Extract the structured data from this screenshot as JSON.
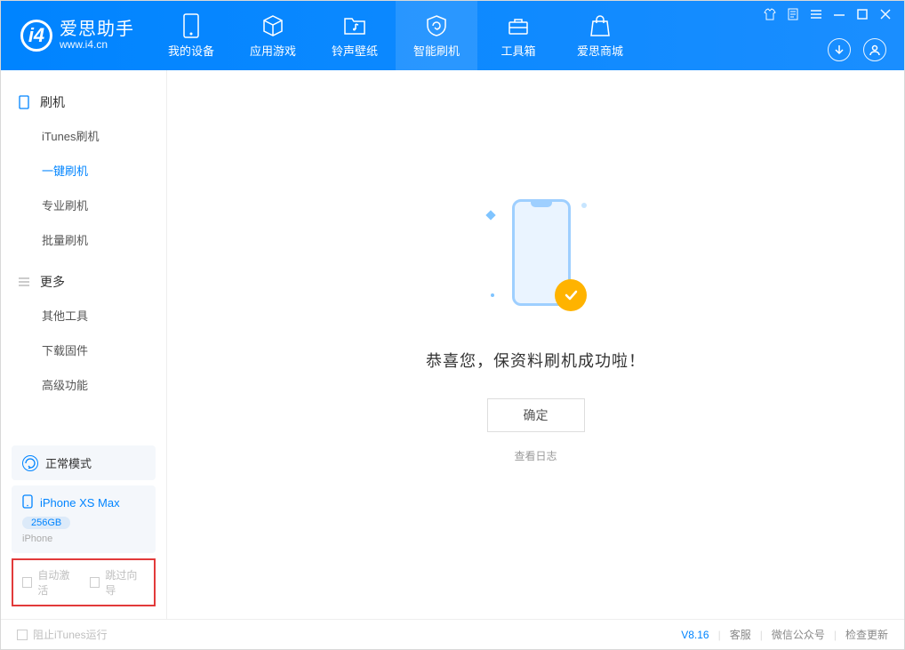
{
  "app": {
    "title": "爱思助手",
    "url": "www.i4.cn"
  },
  "tabs": [
    {
      "id": "device",
      "label": "我的设备"
    },
    {
      "id": "apps",
      "label": "应用游戏"
    },
    {
      "id": "ring",
      "label": "铃声壁纸"
    },
    {
      "id": "flash",
      "label": "智能刷机"
    },
    {
      "id": "toolbox",
      "label": "工具箱"
    },
    {
      "id": "store",
      "label": "爱思商城"
    }
  ],
  "sidebar": {
    "sections": [
      {
        "title": "刷机",
        "items": [
          {
            "label": "iTunes刷机",
            "active": false
          },
          {
            "label": "一键刷机",
            "active": true
          },
          {
            "label": "专业刷机",
            "active": false
          },
          {
            "label": "批量刷机",
            "active": false
          }
        ]
      },
      {
        "title": "更多",
        "items": [
          {
            "label": "其他工具",
            "active": false
          },
          {
            "label": "下载固件",
            "active": false
          },
          {
            "label": "高级功能",
            "active": false
          }
        ]
      }
    ],
    "mode": "正常模式",
    "device": {
      "name": "iPhone XS Max",
      "capacity": "256GB",
      "type": "iPhone"
    },
    "checks": {
      "auto_activate": "自动激活",
      "skip_guide": "跳过向导"
    }
  },
  "main": {
    "success_msg": "恭喜您，保资料刷机成功啦！",
    "ok": "确定",
    "view_log": "查看日志"
  },
  "statusbar": {
    "block_itunes": "阻止iTunes运行",
    "version": "V8.16",
    "links": [
      "客服",
      "微信公众号",
      "检查更新"
    ]
  }
}
